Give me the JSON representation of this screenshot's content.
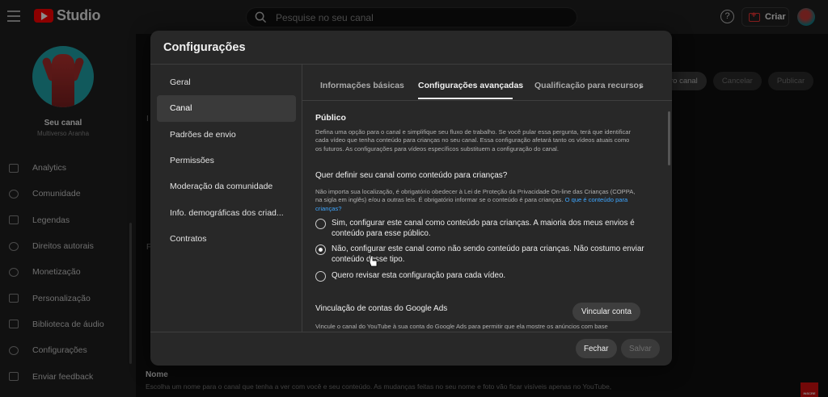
{
  "topbar": {
    "logo_text": "Studio",
    "search_placeholder": "Pesquise no seu canal",
    "help_icon": "?",
    "create_label": "Criar"
  },
  "sidebar": {
    "channel_name": "Seu canal",
    "channel_subtitle": "Multiverso Aranha",
    "items": [
      {
        "label": "Analytics",
        "icon": "analytics-icon"
      },
      {
        "label": "Comunidade",
        "icon": "community-icon"
      },
      {
        "label": "Legendas",
        "icon": "subtitles-icon"
      },
      {
        "label": "Direitos autorais",
        "icon": "copyright-icon"
      },
      {
        "label": "Monetização",
        "icon": "dollar-icon"
      },
      {
        "label": "Personalização",
        "icon": "magic-wand-icon"
      },
      {
        "label": "Biblioteca de áudio",
        "icon": "audio-library-icon"
      },
      {
        "label": "Configurações",
        "icon": "gear-icon"
      },
      {
        "label": "Enviar feedback",
        "icon": "feedback-icon"
      }
    ]
  },
  "background": {
    "buttons": [
      "ro canal",
      "Cancelar",
      "Publicar"
    ],
    "field_label": "Nome",
    "field_desc": "Escolha um nome para o canal que tenha a ver com você e seu conteúdo. As mudanças feitas no seu nome e foto vão ficar visíveis apenas no YouTube,",
    "ghost_i": "I",
    "ghost_f": "F"
  },
  "modal": {
    "title": "Configurações",
    "nav": [
      "Geral",
      "Canal",
      "Padrões de envio",
      "Permissões",
      "Moderação da comunidade",
      "Info. demográficas dos criad...",
      "Contratos"
    ],
    "active_nav": "Canal",
    "tabs": [
      "Informações básicas",
      "Configurações avançadas",
      "Qualificação para recursos"
    ],
    "active_tab": "Configurações avançadas",
    "section_title": "Público",
    "section_desc": "Defina uma opção para o canal e simplifique seu fluxo de trabalho. Se você pular essa pergunta, terá que identificar cada vídeo que tenha conteúdo para crianças no seu canal. Essa configuração afetará tanto os vídeos atuais como os futuros. As configurações para vídeos específicos substituem a configuração do canal.",
    "question": "Quer definir seu canal como conteúdo para crianças?",
    "law_text": "Não importa sua localização, é obrigatório obedecer à Lei de Proteção da Privacidade On-line das Crianças (COPPA, na sigla em inglês) e/ou a outras leis. É obrigatório informar se o conteúdo é para crianças.",
    "law_link": "O que é conteúdo para crianças?",
    "options": [
      {
        "label": "Sim, configurar este canal como conteúdo para crianças. A maioria dos meus envios é conteúdo para esse público.",
        "checked": false
      },
      {
        "label": "Não, configurar este canal como não sendo conteúdo para crianças. Não costumo enviar conteúdo desse tipo.",
        "checked": true
      },
      {
        "label": "Quero revisar esta configuração para cada vídeo.",
        "checked": false
      }
    ],
    "ads_title": "Vinculação de contas do Google Ads",
    "ads_button": "Vincular conta",
    "ads_desc": "Vincule o canal do YouTube à sua conta do Google Ads para permitir que ela mostre os anúncios com base",
    "close_label": "Fechar",
    "save_label": "Salvar"
  },
  "corner_badge": "INSCRE"
}
